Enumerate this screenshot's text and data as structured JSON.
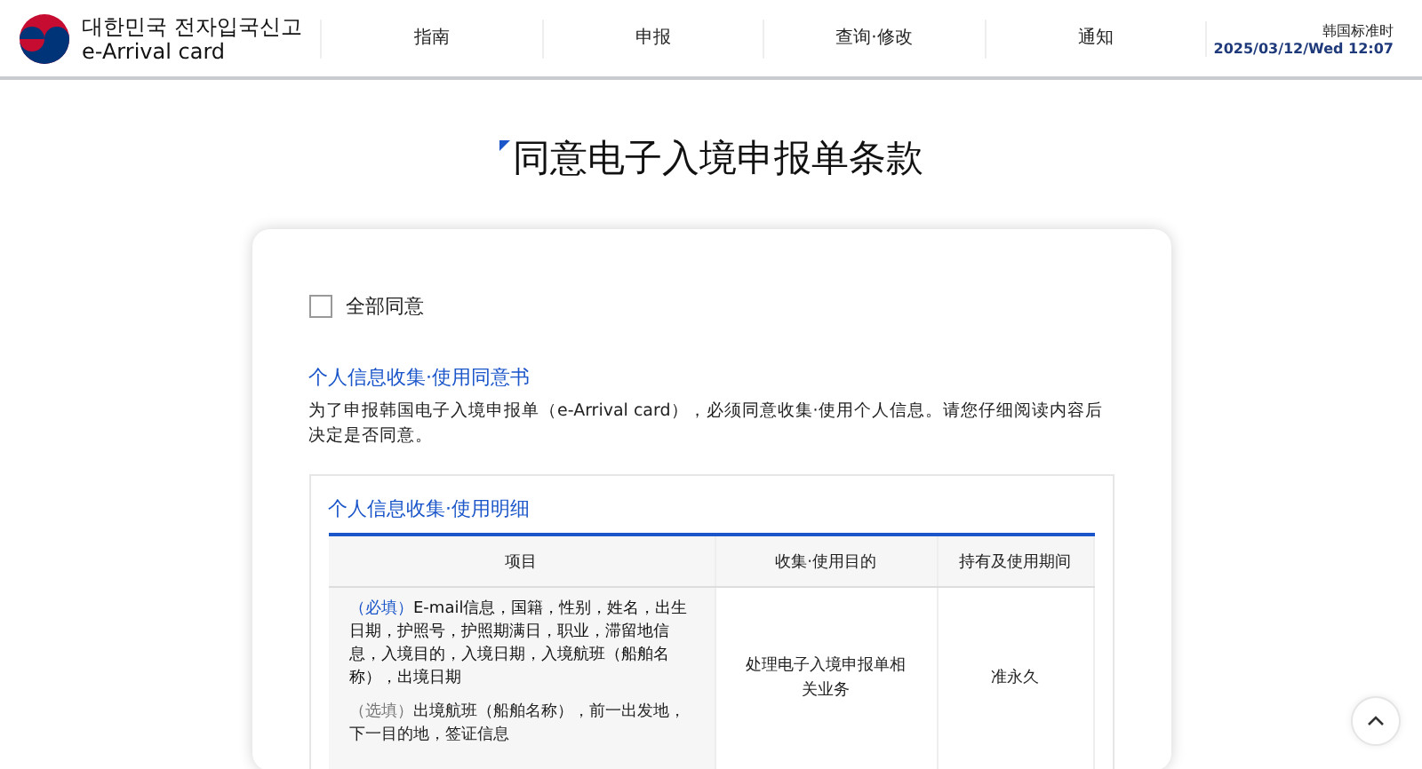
{
  "header": {
    "logo_title": "대한민국 전자입국신고",
    "logo_subtitle": "e-Arrival card",
    "nav": [
      {
        "label": "指南",
        "selected": false
      },
      {
        "label": "申报",
        "selected": false
      },
      {
        "label": "查询·修改",
        "selected": false
      },
      {
        "label": "通知",
        "selected": false
      }
    ],
    "clock": {
      "label": "韩国标准时",
      "value": "2025/03/12/Wed 12:07"
    }
  },
  "page_title": "同意电子入境申报单条款",
  "agree_all": {
    "label": "全部同意",
    "checked": false
  },
  "consent": {
    "title": "个人信息收集·使用同意书",
    "description": "为了申报韩国电子入境申报单（e-Arrival card），必须同意收集·使用个人信息。请您仔细阅读内容后决定是否同意。",
    "details": {
      "title": "个人信息收集·使用明细",
      "table": {
        "columns": [
          "项目",
          "收集·使用目的",
          "持有及使用期间"
        ],
        "rows": [
          {
            "items": [
              {
                "kind": "required",
                "tag": "（必填）",
                "text": "E-mail信息，国籍，性别，姓名，出生日期，护照号，护照期满日，职业，滞留地信息，入境目的，入境日期，入境航班（船舶名称），出境日期"
              },
              {
                "kind": "optional",
                "tag": "（选填）",
                "text": "出境航班（船舶名称），前一出发地，下一目的地，签证信息"
              }
            ],
            "purpose": "处理电子入境申报单相关业务",
            "period": "准永久"
          }
        ]
      }
    }
  }
}
